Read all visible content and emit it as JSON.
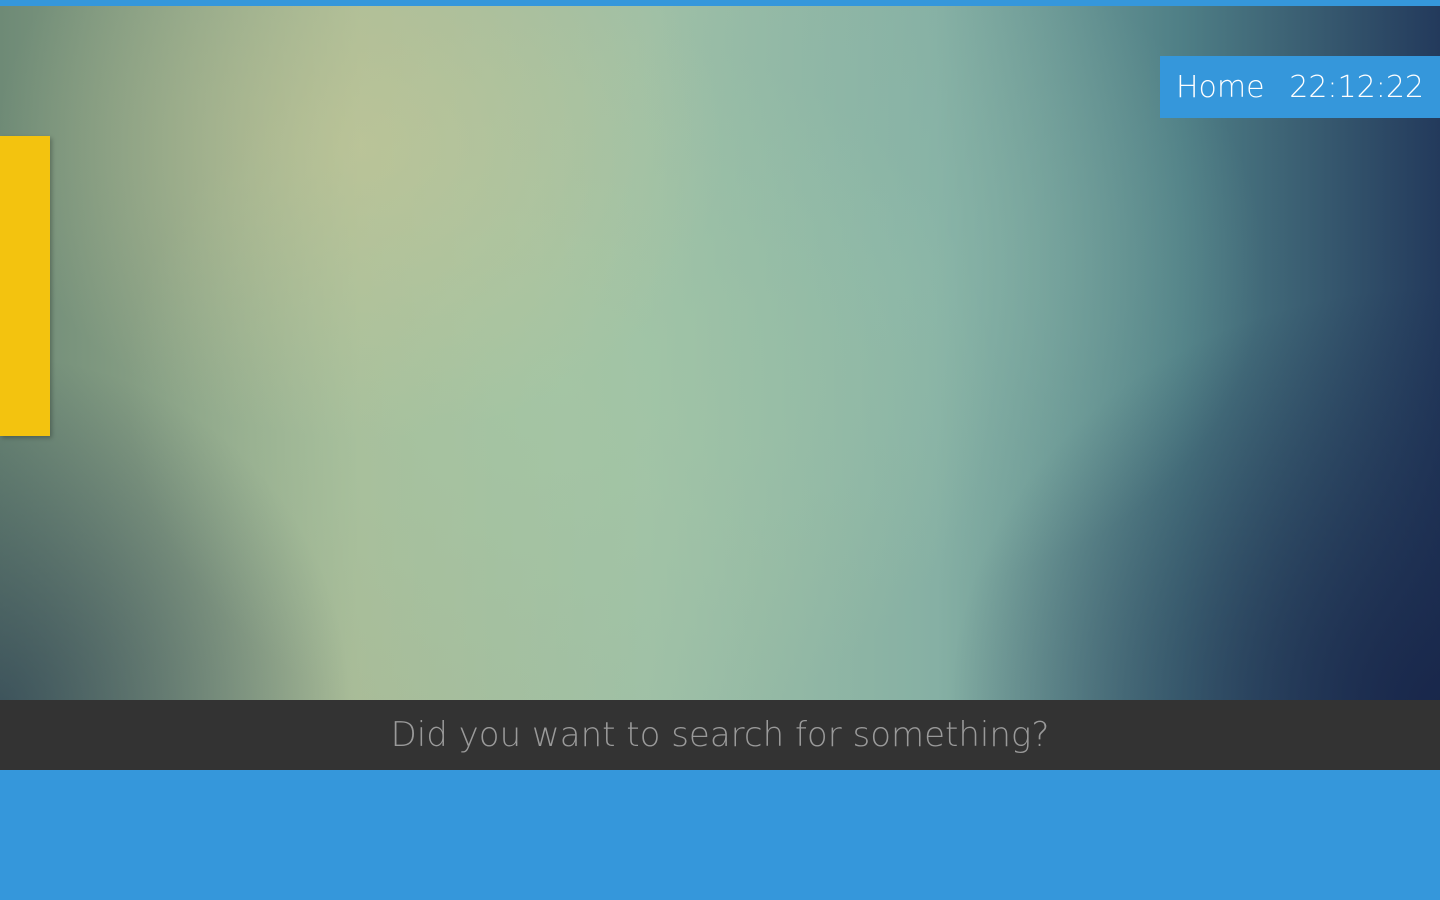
{
  "header": {
    "location_label": "Home",
    "clock": "22:12:22"
  },
  "search": {
    "prompt": "Did you want to search for something?"
  },
  "colors": {
    "accent": "#3597db",
    "side_tab": "#f3c30f",
    "search_bar": "#333333",
    "search_text": "#9a9a9a"
  }
}
